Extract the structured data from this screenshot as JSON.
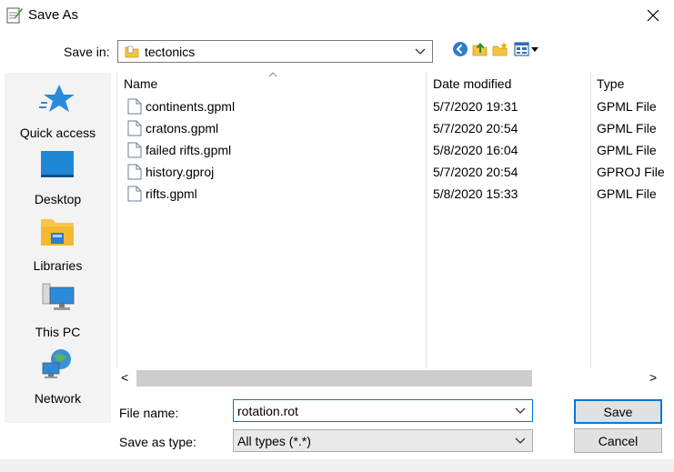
{
  "window": {
    "title": "Save As",
    "close_glyph": "✕"
  },
  "toolbar": {
    "save_in_label": "Save in:",
    "folder": "tectonics",
    "icons": [
      "back-icon",
      "up-folder-icon",
      "new-folder-icon",
      "view-menu-icon"
    ]
  },
  "places": [
    {
      "label": "Quick access",
      "icon": "star-icon"
    },
    {
      "label": "Desktop",
      "icon": "desktop-icon"
    },
    {
      "label": "Libraries",
      "icon": "libraries-icon"
    },
    {
      "label": "This PC",
      "icon": "computer-icon"
    },
    {
      "label": "Network",
      "icon": "network-icon"
    }
  ],
  "columns": {
    "name": "Name",
    "date": "Date modified",
    "type": "Type"
  },
  "files": [
    {
      "name": "continents.gpml",
      "date": "5/7/2020 19:31",
      "type": "GPML File"
    },
    {
      "name": "cratons.gpml",
      "date": "5/7/2020 20:54",
      "type": "GPML File"
    },
    {
      "name": "failed rifts.gpml",
      "date": "5/8/2020 16:04",
      "type": "GPML File"
    },
    {
      "name": "history.gproj",
      "date": "5/7/2020 20:54",
      "type": "GPROJ File"
    },
    {
      "name": "rifts.gpml",
      "date": "5/8/2020 15:33",
      "type": "GPML File"
    }
  ],
  "scroll": {
    "left_glyph": "<",
    "right_glyph": ">"
  },
  "form": {
    "file_name_label": "File name:",
    "file_name_value": "rotation.rot",
    "type_label": "Save as type:",
    "type_value": "All types (*.*)",
    "save_label": "Save",
    "cancel_label": "Cancel"
  },
  "colors": {
    "accent": "#0078d7",
    "folder": "#f5c342",
    "selection_border": "#0078d7"
  }
}
